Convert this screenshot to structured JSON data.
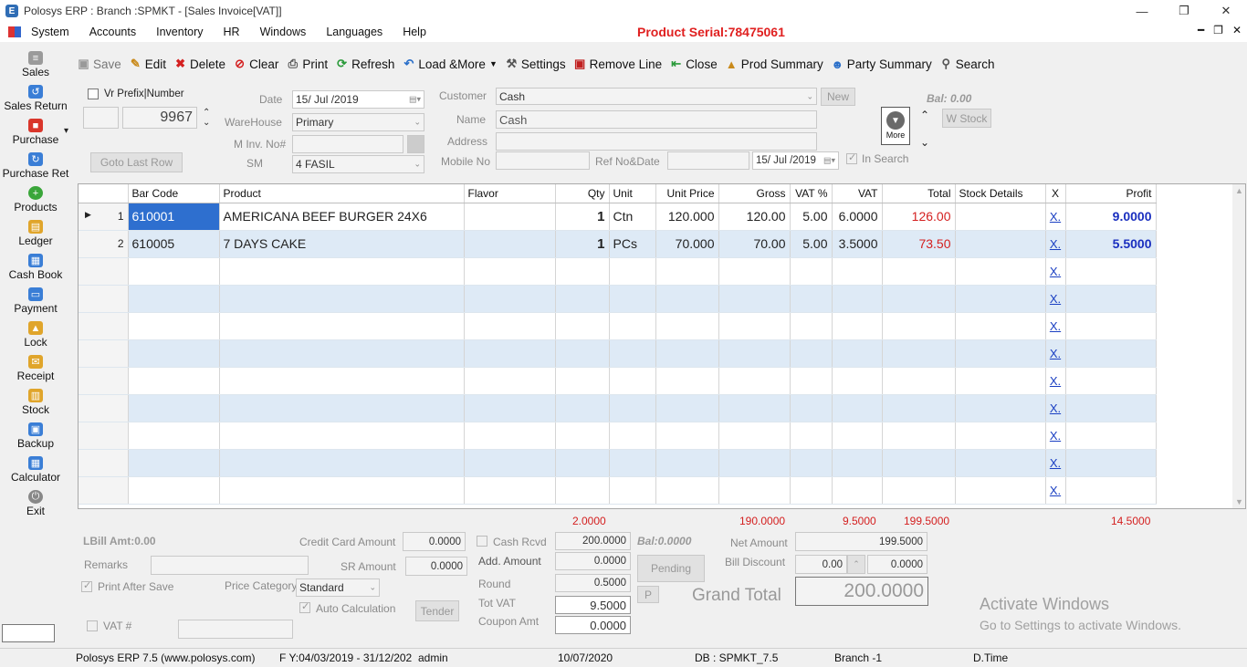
{
  "window": {
    "title": "Polosys ERP :  Branch :SPMKT  - [Sales Invoice[VAT]]",
    "app_icon": "E"
  },
  "menu": [
    "System",
    "Accounts",
    "Inventory",
    "HR",
    "Windows",
    "Languages",
    "Help"
  ],
  "product_serial": "Product Serial:78475061",
  "sidebar": [
    {
      "label": "Sales",
      "icon": "receipt-icon",
      "color": "#9a9a9a"
    },
    {
      "label": "Sales Return",
      "icon": "return-icon",
      "color": "#3a7ed6"
    },
    {
      "label": "Purchase",
      "icon": "cart-icon",
      "color": "#d9362b"
    },
    {
      "label": "Purchase Ret",
      "icon": "purchase-return-icon",
      "color": "#3a7ed6"
    },
    {
      "label": "Products",
      "icon": "plus-icon",
      "color": "#3aa63a"
    },
    {
      "label": "Ledger",
      "icon": "book-icon",
      "color": "#e0a52b"
    },
    {
      "label": "Cash Book",
      "icon": "cashbook-icon",
      "color": "#3a7ed6"
    },
    {
      "label": "Payment",
      "icon": "payment-icon",
      "color": "#3a7ed6"
    },
    {
      "label": "Lock",
      "icon": "lock-icon",
      "color": "#e0a52b"
    },
    {
      "label": "Receipt",
      "icon": "envelope-icon",
      "color": "#e0a52b"
    },
    {
      "label": "Stock",
      "icon": "stock-icon",
      "color": "#e0a52b"
    },
    {
      "label": "Backup",
      "icon": "backup-icon",
      "color": "#3a7ed6"
    },
    {
      "label": "Calculator",
      "icon": "calculator-icon",
      "color": "#3a7ed6"
    },
    {
      "label": "Exit",
      "icon": "power-icon",
      "color": "#888888"
    }
  ],
  "toolbar": {
    "save": "Save",
    "edit": "Edit",
    "delete": "Delete",
    "clear": "Clear",
    "print": "Print",
    "refresh": "Refresh",
    "load_more": "Load &More",
    "settings": "Settings",
    "remove_line": "Remove Line",
    "close": "Close",
    "prod_summary": "Prod Summary",
    "party_summary": "Party Summary",
    "search": "Search"
  },
  "header": {
    "vr_prefix_label": "Vr Prefix|Number",
    "voucher_number": "9967",
    "goto_last_row": "Goto Last Row",
    "date_label": "Date",
    "date_value": "15/ Jul /2019",
    "warehouse_label": "WareHouse",
    "warehouse_value": "Primary",
    "minv_label": "M Inv. No#",
    "sm_label": "SM",
    "sm_value": "4 FASIL",
    "customer_label": "Customer",
    "customer_value": "Cash",
    "new_button": "New",
    "name_label": "Name",
    "name_value": "Cash",
    "address_label": "Address",
    "mobile_label": "Mobile No",
    "refno_label": "Ref No&Date",
    "ref_date_value": "15/ Jul /2019",
    "in_search_label": "In Search",
    "bal_label": "Bal: 0.00",
    "more_label": "More",
    "wstock_button": "W Stock"
  },
  "grid": {
    "columns": [
      "Bar Code",
      "Product",
      "Flavor",
      "Qty",
      "Unit",
      "Unit Price",
      "Gross",
      "VAT %",
      "VAT",
      "Total",
      "Stock Details",
      "X",
      "Profit"
    ],
    "rows": [
      {
        "no": "1",
        "barcode": "610001",
        "product": "AMERICANA BEEF BURGER 24X6",
        "flavor": "",
        "qty": "1",
        "unit": "Ctn",
        "unit_price": "120.000",
        "gross": "120.00",
        "vat_pct": "5.00",
        "vat": "6.0000",
        "total": "126.00",
        "stock": "",
        "x": "X.",
        "profit": "9.0000"
      },
      {
        "no": "2",
        "barcode": "610005",
        "product": "7 DAYS CAKE",
        "flavor": "",
        "qty": "1",
        "unit": "PCs",
        "unit_price": "70.000",
        "gross": "70.00",
        "vat_pct": "5.00",
        "vat": "3.5000",
        "total": "73.50",
        "stock": "",
        "x": "X.",
        "profit": "5.5000"
      }
    ],
    "empty_x": "X."
  },
  "totals": {
    "qty": "2.0000",
    "gross": "190.0000",
    "vat": "9.5000",
    "total": "199.5000",
    "profit": "14.5000"
  },
  "footer": {
    "lbill": "LBill Amt:0.00",
    "remarks_label": "Remarks",
    "print_after_save": "Print After Save",
    "price_category_label": "Price Category",
    "price_category_value": "Standard",
    "auto_calc": "Auto Calculation",
    "tender": "Tender",
    "vat_no_label": "VAT #",
    "credit_card_label": "Credit Card Amount",
    "credit_card_value": "0.0000",
    "sr_amount_label": "SR Amount",
    "sr_amount_value": "0.0000",
    "cash_rcvd_label": "Cash Rcvd",
    "cash_rcvd_value": "200.0000",
    "bal": "Bal:0.0000",
    "add_amount_label": "Add. Amount",
    "add_amount_value": "0.0000",
    "pending": "Pending",
    "round_label": "Round",
    "round_value": "0.5000",
    "p_button": "P",
    "tot_vat_label": "Tot VAT",
    "tot_vat_value": "9.5000",
    "coupon_label": "Coupon Amt",
    "coupon_value": "0.0000",
    "net_amount_label": "Net Amount",
    "net_amount_value": "199.5000",
    "bill_discount_label": "Bill Discount",
    "bill_discount_pct": "0.00",
    "bill_discount_value": "0.0000",
    "grand_total_label": "Grand Total",
    "grand_total_value": "200.0000"
  },
  "watermark": {
    "line1": "Activate Windows",
    "line2": "Go to Settings to activate Windows."
  },
  "status": {
    "product": "Polosys ERP 7.5  (www.polosys.com)",
    "fy": "F Y:04/03/2019 - 31/12/202",
    "user": "admin",
    "date": "10/07/2020",
    "db": "DB : SPMKT_7.5",
    "branch": "Branch -1",
    "dtime": "D.Time"
  }
}
